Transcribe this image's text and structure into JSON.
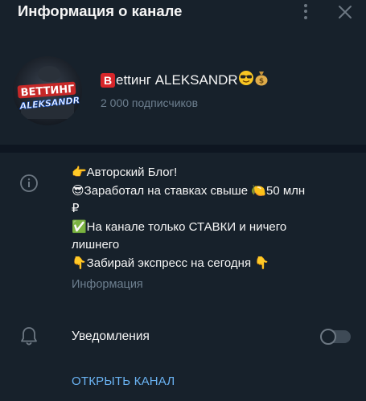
{
  "header": {
    "title": "Информация о канале",
    "menu_icon": "more-vertical-icon",
    "close_icon": "close-icon"
  },
  "channel": {
    "name_text": "ettинг ALEKSANDR",
    "name_b_letter": "B",
    "subscribers": "2 000 подписчиков",
    "avatar_logo_text": "BETTИНГ",
    "avatar_logo_sub": "ALEKSANDR"
  },
  "description": {
    "lines": [
      "👉Авторский Блог!",
      "😎Заработал на ставках свыше 🍋50 млн",
      "₽",
      "✅На канале только СТАВКИ и ничего",
      "лишнего",
      "👇Забирай экспресс на сегодня 👇"
    ],
    "label": "Информация"
  },
  "notifications": {
    "label": "Уведомления",
    "enabled": false
  },
  "actions": {
    "open_channel": "ОТКРЫТЬ КАНАЛ"
  },
  "colors": {
    "background": "#17212b",
    "divider": "#0e1621",
    "accent_link": "#6ab3f3",
    "secondary_text": "#6d7f8f"
  }
}
